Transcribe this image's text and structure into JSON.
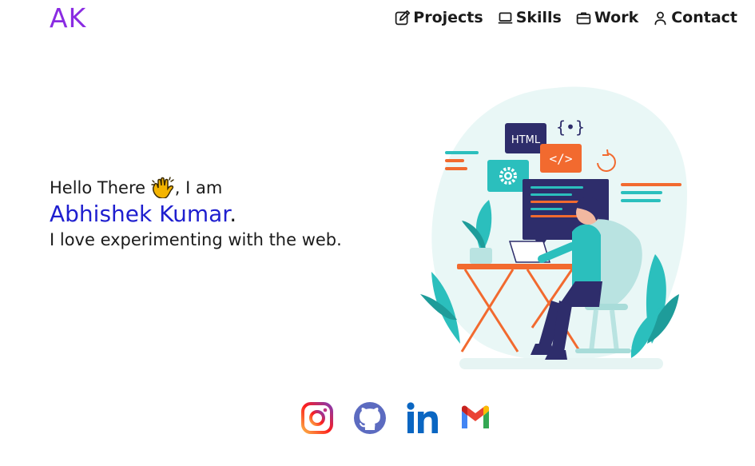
{
  "header": {
    "logo": "AK",
    "nav": [
      {
        "label": "Projects",
        "icon": "edit-icon"
      },
      {
        "label": "Skills",
        "icon": "laptop-icon"
      },
      {
        "label": "Work",
        "icon": "briefcase-icon"
      },
      {
        "label": "Contact",
        "icon": "user-icon"
      }
    ]
  },
  "hero": {
    "greeting_start": "Hello There ",
    "greeting_end": ", I am",
    "name": "Abhishek Kumar",
    "name_suffix": ".",
    "tagline": "I love experimenting with the web."
  },
  "illustration": {
    "html_tag": "HTML",
    "code_tag": "</>",
    "braces_tag": "{•}"
  },
  "socials": [
    {
      "name": "Instagram",
      "icon": "instagram-icon"
    },
    {
      "name": "GitHub",
      "icon": "github-icon"
    },
    {
      "name": "LinkedIn",
      "icon": "linkedin-icon"
    },
    {
      "name": "Gmail",
      "icon": "gmail-icon"
    }
  ],
  "colors": {
    "logo": "#8a2be2",
    "name": "#1f1fcf",
    "teal": "#2bbfbd",
    "orange": "#f26a2f",
    "navy": "#2e2d6b"
  }
}
